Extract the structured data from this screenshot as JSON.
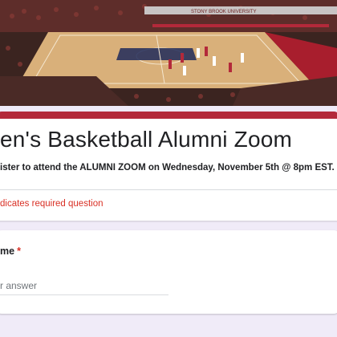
{
  "banner": {
    "arena_sign": "STONY BROOK UNIVERSITY",
    "colors": {
      "court": "#d9b07a",
      "crowd": "#7a2a2a",
      "accent": "#b3293a"
    }
  },
  "form": {
    "title": "en's Basketball Alumni Zoom",
    "description": "ister to attend the ALUMNI ZOOM on Wednesday, November 5th @ 8pm EST.",
    "required_note": "dicates required question",
    "accent_color": "#b3293a"
  },
  "question": {
    "label": "me",
    "required_marker": "*",
    "placeholder": "r answer"
  }
}
